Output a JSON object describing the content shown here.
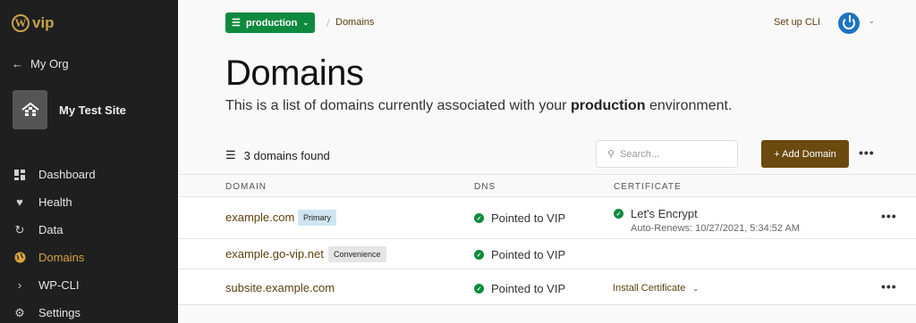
{
  "sidebar": {
    "logo_text": "vip",
    "logo_mark": "W",
    "back_label": "My Org",
    "site_name": "My Test Site",
    "items": [
      {
        "label": "Dashboard",
        "icon": "dashboard-icon"
      },
      {
        "label": "Health",
        "icon": "heart-icon"
      },
      {
        "label": "Data",
        "icon": "sync-icon"
      },
      {
        "label": "Domains",
        "icon": "globe-icon",
        "active": true
      },
      {
        "label": "WP-CLI",
        "icon": "chevron-right-icon"
      },
      {
        "label": "Settings",
        "icon": "gear-icon"
      }
    ],
    "active_color": "#d9a441"
  },
  "header": {
    "environment": "production",
    "breadcrumb": "Domains",
    "setup_cli": "Set up CLI"
  },
  "page": {
    "title": "Domains",
    "desc_before": "This is a list of domains currently associated with your",
    "desc_bold": "production",
    "desc_after": "environment."
  },
  "toolbar": {
    "count_label": "3 domains found",
    "search_placeholder": "Search...",
    "add_label": "+ Add Domain"
  },
  "table": {
    "headers": [
      "DOMAIN",
      "DNS",
      "CERTIFICATE"
    ],
    "rows": [
      {
        "domain": "example.com",
        "badge": "Primary",
        "dns": "Pointed to VIP",
        "cert": "Let's Encrypt",
        "cert_sub": "Auto-Renews: 10/27/2021, 5:34:52 AM"
      },
      {
        "domain": "example.go-vip.net",
        "badge": "Convenience",
        "dns": "Pointed to VIP"
      },
      {
        "domain": "subsite.example.com",
        "dns": "Pointed to VIP",
        "cert_action": "Install Certificate"
      }
    ]
  },
  "colors": {
    "env_green": "#0e8a3e",
    "brand_brown": "#6b4a0f",
    "link_brown": "#5c3e0a",
    "avatar_blue": "#1b74c2"
  }
}
